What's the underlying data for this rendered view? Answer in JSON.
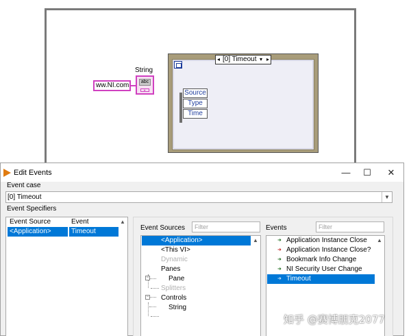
{
  "diagram": {
    "string_constant": "ww.NI.com",
    "string_label": "String",
    "indicator_tag": "abc",
    "event_case_selector": "[0] Timeout",
    "event_nodes": [
      "Source",
      "Type",
      "Time"
    ]
  },
  "dialog": {
    "title": "Edit Events",
    "window_buttons": {
      "minimize": "—",
      "maximize": "☐",
      "close": "✕"
    },
    "event_case_label": "Event case",
    "event_case_value": "[0] Timeout",
    "event_specifiers_label": "Event Specifiers",
    "specifiers": {
      "columns": [
        "Event Source",
        "Event"
      ],
      "rows": [
        {
          "source": "<Application>",
          "event": "Timeout"
        }
      ]
    },
    "event_sources": {
      "label": "Event Sources",
      "filter_placeholder": "Filter",
      "items": [
        "<Application>",
        "<This VI>",
        "Dynamic",
        "Panes",
        "Pane",
        "Splitters",
        "Controls",
        "String"
      ]
    },
    "events": {
      "label": "Events",
      "filter_placeholder": "Filter",
      "items": [
        "Application Instance Close",
        "Application Instance Close?",
        "Bookmark Info Change",
        "NI Security User Change",
        "Timeout"
      ]
    }
  },
  "watermark": "知乎 @赛博朋克2077",
  "colors": {
    "selection": "#0078d7",
    "string_wire": "#d040c0",
    "node_text": "#1f3d9e",
    "event_struct_border": "#a89c7a"
  }
}
